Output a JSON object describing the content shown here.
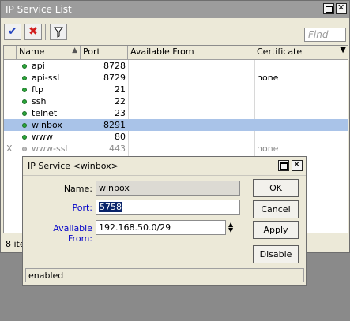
{
  "main_window": {
    "title": "IP Service List",
    "find_placeholder": "Find",
    "columns": [
      "Name",
      "Port",
      "Available From",
      "Certificate"
    ],
    "rows": [
      {
        "flag": "",
        "name": "api",
        "port": "8728",
        "available_from": "",
        "certificate": "",
        "selected": false,
        "disabled": false
      },
      {
        "flag": "",
        "name": "api-ssl",
        "port": "8729",
        "available_from": "",
        "certificate": "none",
        "selected": false,
        "disabled": false
      },
      {
        "flag": "",
        "name": "ftp",
        "port": "21",
        "available_from": "",
        "certificate": "",
        "selected": false,
        "disabled": false
      },
      {
        "flag": "",
        "name": "ssh",
        "port": "22",
        "available_from": "",
        "certificate": "",
        "selected": false,
        "disabled": false
      },
      {
        "flag": "",
        "name": "telnet",
        "port": "23",
        "available_from": "",
        "certificate": "",
        "selected": false,
        "disabled": false
      },
      {
        "flag": "",
        "name": "winbox",
        "port": "8291",
        "available_from": "",
        "certificate": "",
        "selected": true,
        "disabled": false
      },
      {
        "flag": "",
        "name": "www",
        "port": "80",
        "available_from": "",
        "certificate": "",
        "selected": false,
        "disabled": false
      },
      {
        "flag": "X",
        "name": "www-ssl",
        "port": "443",
        "available_from": "",
        "certificate": "none",
        "selected": false,
        "disabled": true
      }
    ],
    "status_text": "8 ite"
  },
  "dialog": {
    "title": "IP Service <winbox>",
    "name_label": "Name:",
    "name_value": "winbox",
    "port_label": "Port:",
    "port_value": "5758",
    "available_from_label": "Available From:",
    "available_from_value": "192.168.50.0/29",
    "buttons": {
      "ok": "OK",
      "cancel": "Cancel",
      "apply": "Apply",
      "disable": "Disable"
    },
    "status": "enabled"
  },
  "colors": {
    "selected_row": "#a9c3e8",
    "enable_check": "#1f3fbf",
    "disable_cross": "#d21b1b",
    "status_dot": "#2aa63a"
  }
}
